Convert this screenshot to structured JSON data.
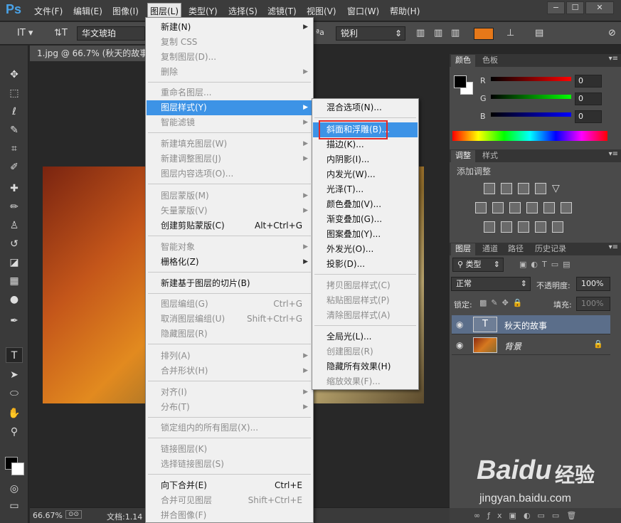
{
  "app": {
    "logo": "Ps"
  },
  "menubar": {
    "items": [
      "文件(F)",
      "编辑(E)",
      "图像(I)",
      "图层(L)",
      "类型(Y)",
      "选择(S)",
      "滤镜(T)",
      "视图(V)",
      "窗口(W)",
      "帮助(H)"
    ]
  },
  "window_controls": [
    "−",
    "☐",
    "✕"
  ],
  "options": {
    "font": "华文琥珀",
    "aa_label": "ªa",
    "antialias": "锐利",
    "text_color": "#e67819"
  },
  "document": {
    "tab": "1.jpg @ 66.7% (秋天的故事,"
  },
  "status": {
    "zoom": "66.67%",
    "doc": "文档:1.14"
  },
  "layer_menu": {
    "new": "新建(N)",
    "copy_css": "复制 CSS",
    "duplicate": "复制图层(D)...",
    "delete": "删除",
    "rename": "重命名图层...",
    "layer_style": "图层样式(Y)",
    "smart_filter": "智能滤镜",
    "new_fill": "新建填充图层(W)",
    "new_adjust": "新建调整图层(J)",
    "content_opts": "图层内容选项(O)...",
    "layer_mask": "图层蒙版(M)",
    "vector_mask": "矢量蒙版(V)",
    "clip_mask": "创建剪贴蒙版(C)",
    "clip_mask_sc": "Alt+Ctrl+G",
    "smart_obj": "智能对象",
    "rasterize": "栅格化(Z)",
    "slice": "新建基于图层的切片(B)",
    "group": "图层编组(G)",
    "group_sc": "Ctrl+G",
    "ungroup": "取消图层编组(U)",
    "ungroup_sc": "Shift+Ctrl+G",
    "hide": "隐藏图层(R)",
    "arrange": "排列(A)",
    "combine": "合并形状(H)",
    "align": "对齐(I)",
    "distribute": "分布(T)",
    "lock_all": "锁定组内的所有图层(X)...",
    "link": "链接图层(K)",
    "select_linked": "选择链接图层(S)",
    "merge_down": "向下合并(E)",
    "merge_down_sc": "Ctrl+E",
    "merge_visible": "合并可见图层",
    "merge_visible_sc": "Shift+Ctrl+E",
    "flatten": "拼合图像(F)"
  },
  "style_menu": {
    "blend": "混合选项(N)...",
    "bevel": "斜面和浮雕(B)...",
    "stroke": "描边(K)...",
    "inner_shadow": "内阴影(I)...",
    "inner_glow": "内发光(W)...",
    "satin": "光泽(T)...",
    "color_overlay": "颜色叠加(V)...",
    "gradient_overlay": "渐变叠加(G)...",
    "pattern_overlay": "图案叠加(Y)...",
    "outer_glow": "外发光(O)...",
    "drop_shadow": "投影(D)...",
    "copy_style": "拷贝图层样式(C)",
    "paste_style": "粘贴图层样式(P)",
    "clear_style": "清除图层样式(A)",
    "global_light": "全局光(L)...",
    "create_layers": "创建图层(R)",
    "hide_effects": "隐藏所有效果(H)",
    "scale_effects": "缩放效果(F)..."
  },
  "color_panel": {
    "tabs": [
      "颜色",
      "色板"
    ],
    "r_label": "R",
    "g_label": "G",
    "b_label": "B",
    "r": "0",
    "g": "0",
    "b": "0"
  },
  "adjust_panel": {
    "tabs": [
      "调整",
      "样式"
    ],
    "title": "添加调整"
  },
  "layers_panel": {
    "tabs": [
      "图层",
      "通道",
      "路径",
      "历史记录"
    ],
    "filter": "类型",
    "blend": "正常",
    "opacity_label": "不透明度:",
    "opacity": "100%",
    "lock_label": "锁定:",
    "fill_label": "填充:",
    "fill": "100%",
    "layers": [
      {
        "name": "秋天的故事",
        "type": "T"
      },
      {
        "name": "背景"
      }
    ]
  },
  "watermark": {
    "brand": "Baidu",
    "suffix": "经验",
    "url": "jingyan.baidu.com"
  }
}
